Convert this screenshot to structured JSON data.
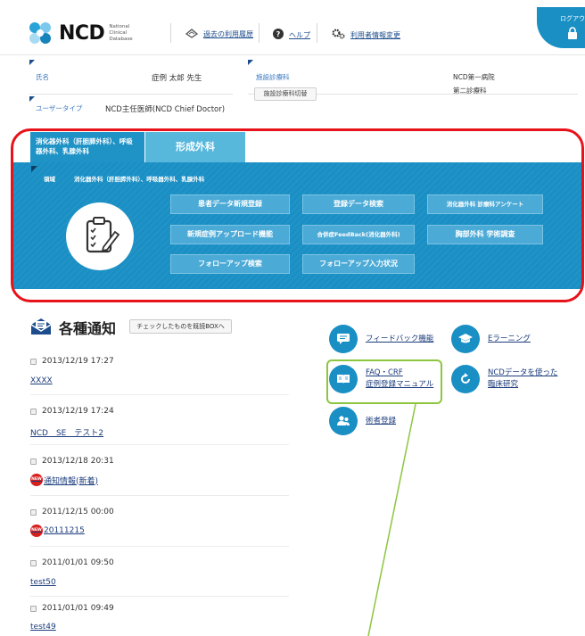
{
  "header": {
    "logo": "NCD",
    "logo_sub": [
      "National",
      "Clinical",
      "Database"
    ],
    "history_link": "過去の利用履歴",
    "help_link": "ヘルプ",
    "user_change_link": "利用者情報変更",
    "logout": "ログアウ"
  },
  "user_info": {
    "name_label": "氏名",
    "name_value": "症例 太郎 先生",
    "user_type_label": "ユーザータイプ",
    "user_type_value": "NCD主任医師(NCD Chief Doctor)",
    "facility_label": "施設診療科",
    "facility_switch_button": "施設診療科切替",
    "hospital": "NCD第一病院",
    "department": "第二診療科"
  },
  "tabs": [
    {
      "label": "消化器外科（肝胆膵外科）、呼吸器外科、乳腺外科",
      "active": true
    },
    {
      "label": "形成外科",
      "active": false
    }
  ],
  "panel": {
    "field_label": "領域",
    "field_value": "消化器外科（肝胆膵外科）、呼吸器外科、乳腺外科",
    "buttons": [
      "患者データ新規登録",
      "登録データ検索",
      "消化器外科 診療科アンケート",
      "新規症例アップロード機能",
      "合併症FeedBack(消化器外科)",
      "胸部外科 学術調査",
      "フォローアップ検索",
      "フォローアップ入力状況"
    ]
  },
  "notices": {
    "title": "各種通知",
    "check_button": "チェックしたものを既読BOXへ",
    "items": [
      {
        "date": "2013/12/19 17:27",
        "title": "XXXX",
        "new": false
      },
      {
        "date": "2013/12/19 17:24",
        "title": "NCD　SE　テスト2",
        "new": false
      },
      {
        "date": "2013/12/18 20:31",
        "title": "通知情報(新着)",
        "new": true
      },
      {
        "date": "2011/12/15 00:00",
        "title": "20111215",
        "new": true
      },
      {
        "date": "2011/01/01 09:50",
        "title": "test50",
        "new": false
      },
      {
        "date": "2011/01/01 09:49",
        "title": "test49",
        "new": false
      }
    ],
    "new_badge": "NEW"
  },
  "links": {
    "feedback": "フィードバック機能",
    "elearning": "Eラーニング",
    "faq_line1": "FAQ・CRF",
    "faq_line2": "症例登録マニュアル",
    "research_line1": "NCDデータを使った",
    "research_line2": "臨床研究",
    "surgeon_registration": "術者登録"
  },
  "colors": {
    "primary": "#1a8fc4",
    "tab_inactive": "#58b8dc",
    "link": "#1c3c7c",
    "highlight_red": "#e8121b",
    "highlight_green": "#8cc63f"
  }
}
